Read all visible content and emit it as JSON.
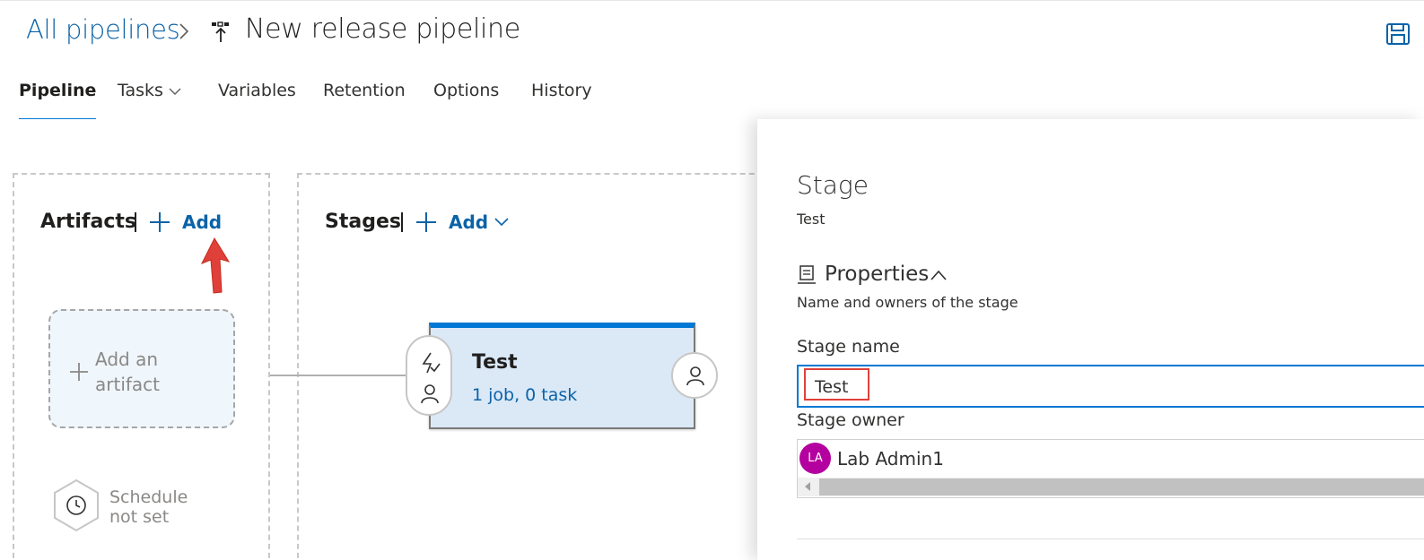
{
  "header": {
    "breadcrumb_root": "All pipelines",
    "title": "New release pipeline"
  },
  "tabs": [
    {
      "label": "Pipeline",
      "active": true
    },
    {
      "label": "Tasks",
      "active": false,
      "has_dropdown": true
    },
    {
      "label": "Variables",
      "active": false
    },
    {
      "label": "Retention",
      "active": false
    },
    {
      "label": "Options",
      "active": false
    },
    {
      "label": "History",
      "active": false
    }
  ],
  "artifacts": {
    "title": "Artifacts",
    "add_label": "Add",
    "add_artifact_label": "Add an artifact",
    "schedule_label": "Schedule not set"
  },
  "stages": {
    "title": "Stages",
    "add_label": "Add",
    "card": {
      "name": "Test",
      "summary": "1 job, 0 task"
    }
  },
  "panel": {
    "heading": "Stage",
    "subheading": "Test",
    "properties_title": "Properties",
    "properties_desc": "Name and owners of the stage",
    "stage_name_label": "Stage name",
    "stage_name_value": "Test",
    "stage_owner_label": "Stage owner",
    "owner_initials": "LA",
    "owner_name": "Lab Admin1"
  },
  "colors": {
    "accent": "#0078d4",
    "link": "#0b63a8",
    "annotation": "#e0403a",
    "avatar": "#b4009e",
    "stage_card_bg": "#dbe9f7"
  },
  "icons": [
    "chevron-right-icon",
    "release-pipeline-icon",
    "save-icon",
    "chevron-down-icon",
    "plus-icon",
    "red-arrow-annotation",
    "clock-icon",
    "lightning-icon",
    "person-icon",
    "properties-icon",
    "chevron-up-icon"
  ]
}
